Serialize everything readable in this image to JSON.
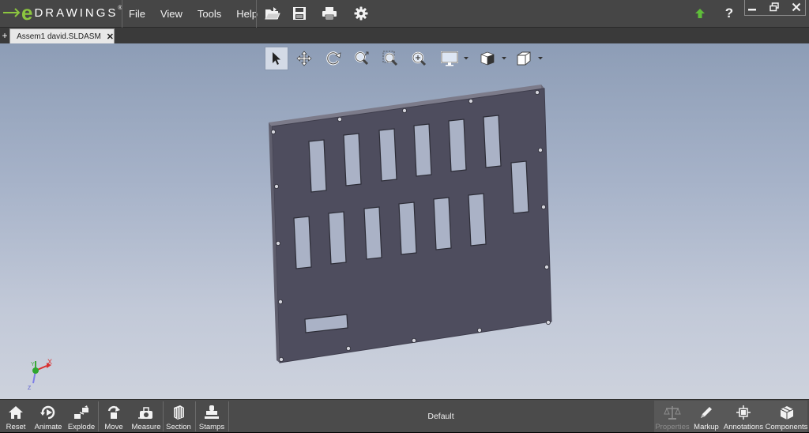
{
  "app": {
    "logo_letter": "e",
    "logo_text": "DRAWINGS",
    "logo_mark": "®"
  },
  "menu": [
    {
      "label": "File"
    },
    {
      "label": "View"
    },
    {
      "label": "Tools"
    },
    {
      "label": "Help"
    }
  ],
  "toolbar_icons": [
    "open-icon",
    "save-icon",
    "print-icon",
    "settings-icon"
  ],
  "title_right_icons": [
    "update-arrow-icon",
    "help-icon"
  ],
  "window_controls": [
    "minimize-icon",
    "restore-icon",
    "close-icon"
  ],
  "tabs": [
    {
      "label": "Assem1 david.SLDASM",
      "active": true
    }
  ],
  "tab_add_label": "+",
  "tab_close_label": "✕",
  "view_tools": [
    "select-icon",
    "pan-icon",
    "rotate-icon",
    "zoom-to-fit-icon",
    "zoom-to-area-icon",
    "zoom-in-out-icon",
    "display-style-icon",
    "view-orientation-icon",
    "standard-views-icon"
  ],
  "triad": {
    "x_label": "X",
    "y_label": "Y",
    "z_label": "Z"
  },
  "bottom_left": [
    {
      "label": "Reset",
      "icon": "home-icon"
    },
    {
      "label": "Animate",
      "icon": "animate-icon"
    },
    {
      "label": "Explode",
      "icon": "explode-icon"
    },
    {
      "label": "Move",
      "icon": "move-icon"
    },
    {
      "label": "Measure",
      "icon": "measure-icon"
    },
    {
      "label": "Section",
      "icon": "section-icon"
    },
    {
      "label": "Stamps",
      "icon": "stamps-icon"
    }
  ],
  "configuration": "Default",
  "bottom_right": [
    {
      "label": "Properties",
      "icon": "properties-icon",
      "enabled": false
    },
    {
      "label": "Markup",
      "icon": "markup-pen-icon",
      "enabled": true
    },
    {
      "label": "Annotations",
      "icon": "annotations-icon",
      "enabled": true
    },
    {
      "label": "Components",
      "icon": "components-icon",
      "enabled": true
    }
  ],
  "colors": {
    "logo_green": "#8cc63f",
    "panel": "#464646",
    "part_face": "#4e4d5e",
    "up_arrow": "#5fbd3a"
  }
}
